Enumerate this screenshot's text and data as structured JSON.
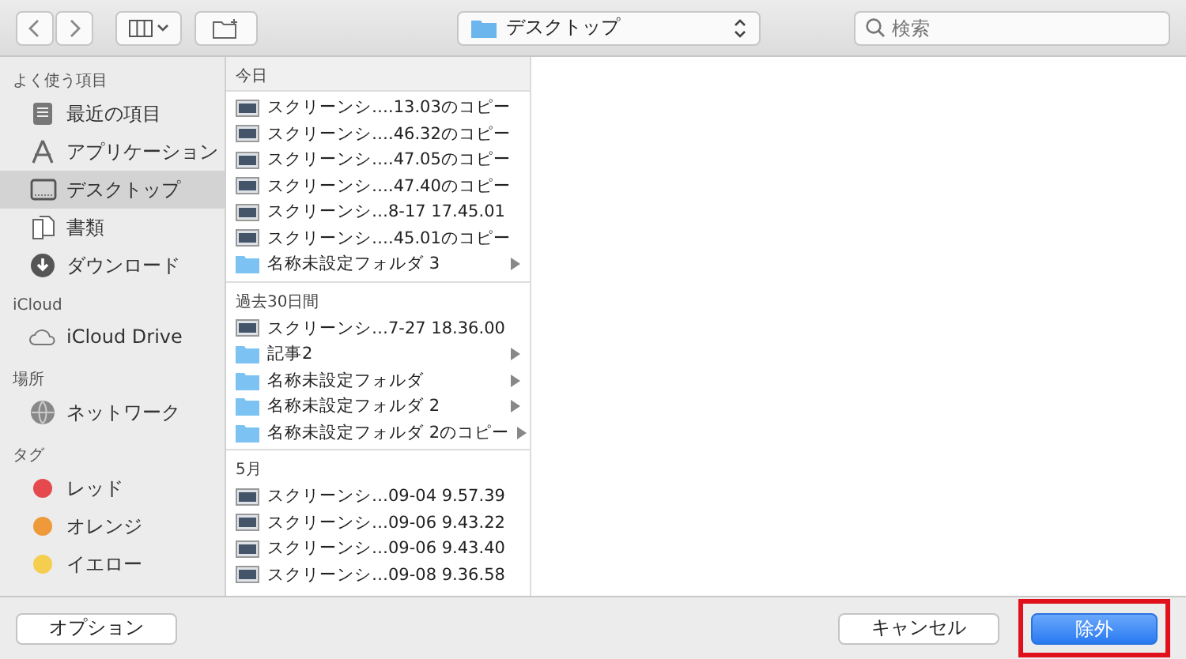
{
  "toolbar": {
    "location": {
      "label": "デスクトップ"
    },
    "search": {
      "placeholder": "検索"
    }
  },
  "sidebar": {
    "sections": [
      {
        "title": "よく使う項目",
        "items": [
          {
            "label": "最近の項目",
            "kind": "recents",
            "selected": false
          },
          {
            "label": "アプリケーション",
            "kind": "apps",
            "selected": false
          },
          {
            "label": "デスクトップ",
            "kind": "desktop",
            "selected": true
          },
          {
            "label": "書類",
            "kind": "documents",
            "selected": false
          },
          {
            "label": "ダウンロード",
            "kind": "downloads",
            "selected": false
          }
        ]
      },
      {
        "title": "iCloud",
        "items": [
          {
            "label": "iCloud Drive",
            "kind": "cloud",
            "selected": false
          }
        ]
      },
      {
        "title": "場所",
        "items": [
          {
            "label": "ネットワーク",
            "kind": "network",
            "selected": false
          }
        ]
      },
      {
        "title": "タグ",
        "items": [
          {
            "label": "レッド",
            "kind": "tag",
            "color": "#e5484d",
            "selected": false
          },
          {
            "label": "オレンジ",
            "kind": "tag",
            "color": "#ee9a3a",
            "selected": false
          },
          {
            "label": "イエロー",
            "kind": "tag",
            "color": "#f5cd4f",
            "selected": false
          }
        ]
      }
    ]
  },
  "files": {
    "sections": [
      {
        "title": "今日",
        "items": [
          {
            "name": "スクリーンシ….13.03のコピー",
            "kind": "screenshot"
          },
          {
            "name": "スクリーンシ….46.32のコピー",
            "kind": "screenshot"
          },
          {
            "name": "スクリーンシ….47.05のコピー",
            "kind": "screenshot"
          },
          {
            "name": "スクリーンシ….47.40のコピー",
            "kind": "screenshot"
          },
          {
            "name": "スクリーンシ…8-17 17.45.01",
            "kind": "screenshot"
          },
          {
            "name": "スクリーンシ….45.01のコピー",
            "kind": "screenshot"
          },
          {
            "name": "名称未設定フォルダ 3",
            "kind": "folder"
          }
        ]
      },
      {
        "title": "過去30日間",
        "items": [
          {
            "name": "スクリーンシ…7-27 18.36.00",
            "kind": "screenshot"
          },
          {
            "name": "記事2",
            "kind": "folder"
          },
          {
            "name": "名称未設定フォルダ",
            "kind": "folder"
          },
          {
            "name": "名称未設定フォルダ 2",
            "kind": "folder"
          },
          {
            "name": "名称未設定フォルダ 2のコピー",
            "kind": "folder"
          }
        ]
      },
      {
        "title": "5月",
        "items": [
          {
            "name": "スクリーンシ…09-04 9.57.39",
            "kind": "screenshot"
          },
          {
            "name": "スクリーンシ…09-06 9.43.22",
            "kind": "screenshot"
          },
          {
            "name": "スクリーンシ…09-06 9.43.40",
            "kind": "screenshot"
          },
          {
            "name": "スクリーンシ…09-08 9.36.58",
            "kind": "screenshot"
          }
        ]
      }
    ]
  },
  "footer": {
    "options": "オプション",
    "cancel": "キャンセル",
    "confirm": {
      "label": "除外",
      "highlighted": true
    }
  }
}
